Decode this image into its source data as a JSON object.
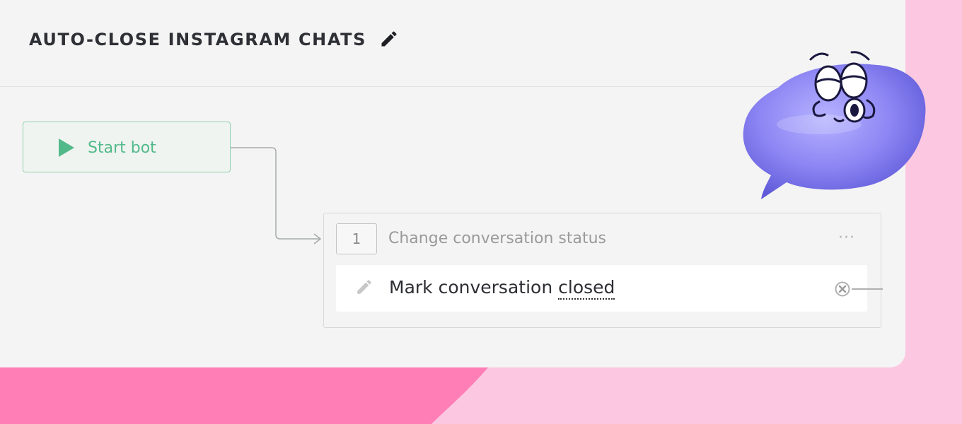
{
  "page": {
    "background_color": "#fcc8e1",
    "accent_color": "#ff7eb6",
    "card_color": "#f4f4f4"
  },
  "header": {
    "title": "AUTO-CLOSE INSTAGRAM CHATS",
    "edit_icon": "pencil-icon"
  },
  "start_node": {
    "label": "Start bot",
    "icon": "play-icon",
    "color": "#52b98a"
  },
  "step": {
    "number": "1",
    "title": "Change conversation status",
    "menu_label": "···",
    "action": {
      "prefix": "Mark conversation ",
      "keyword": "closed",
      "icon": "pencil-icon",
      "remove_icon": "close-circle-icon"
    }
  },
  "mascot": {
    "icon": "speech-bubble-mascot",
    "color": "#8d86f4"
  }
}
